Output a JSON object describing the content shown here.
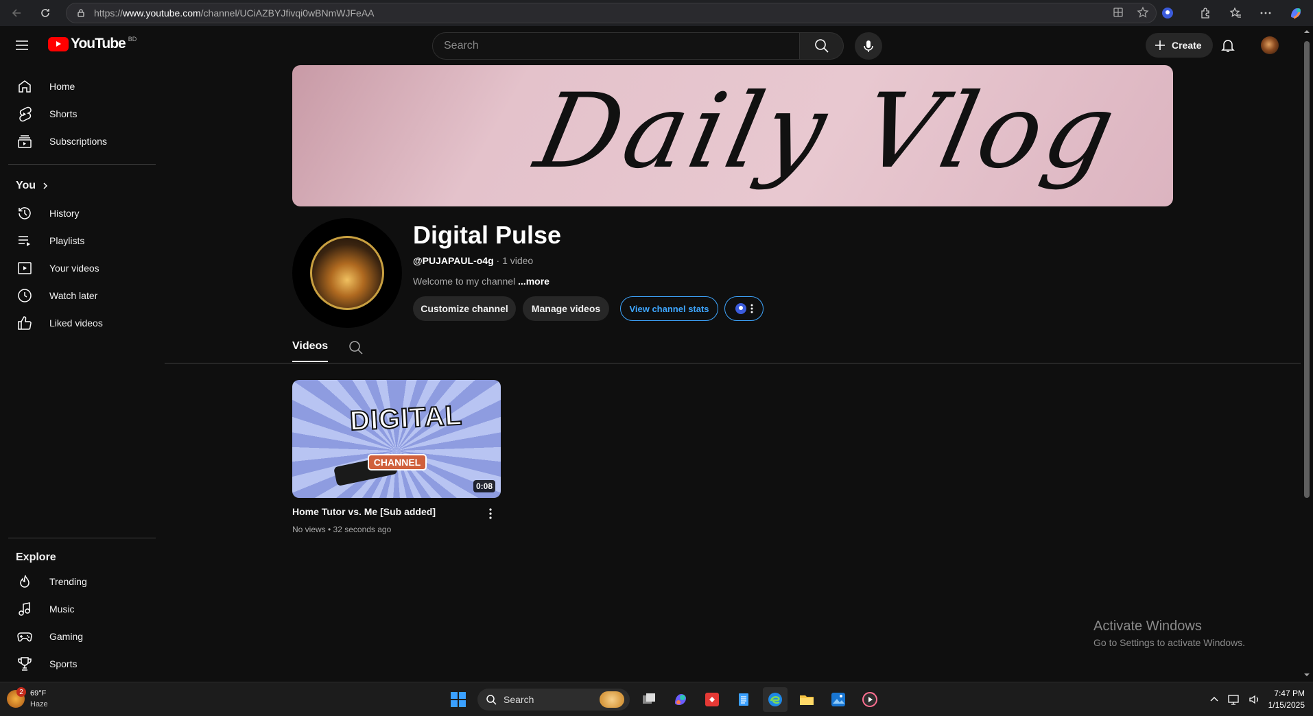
{
  "browser": {
    "url_prefix": "https://",
    "url_host": "www.youtube.com",
    "url_path": "/channel/UCiAZBYJfivqi0wBNmWJFeAA"
  },
  "header": {
    "logo_text": "YouTube",
    "country_code": "BD",
    "search_placeholder": "Search",
    "create_label": "Create"
  },
  "sidebar": {
    "main": [
      {
        "label": "Home",
        "icon": "home-icon"
      },
      {
        "label": "Shorts",
        "icon": "shorts-icon"
      },
      {
        "label": "Subscriptions",
        "icon": "subscriptions-icon"
      }
    ],
    "you_title": "You",
    "you_items": [
      {
        "label": "History",
        "icon": "history-icon"
      },
      {
        "label": "Playlists",
        "icon": "playlists-icon"
      },
      {
        "label": "Your videos",
        "icon": "your-videos-icon"
      },
      {
        "label": "Watch later",
        "icon": "watch-later-icon"
      },
      {
        "label": "Liked videos",
        "icon": "liked-videos-icon"
      }
    ],
    "explore_title": "Explore",
    "explore_items": [
      {
        "label": "Trending",
        "icon": "trending-icon"
      },
      {
        "label": "Music",
        "icon": "music-icon"
      },
      {
        "label": "Gaming",
        "icon": "gaming-icon"
      },
      {
        "label": "Sports",
        "icon": "sports-icon"
      }
    ]
  },
  "banner": {
    "text": "Daily Vlog"
  },
  "channel": {
    "name": "Digital Pulse",
    "handle": "@PUJAPAUL-o4g",
    "video_count": " · 1 video",
    "description": "Welcome to my channel ",
    "more": "...more",
    "buttons": {
      "customize": "Customize channel",
      "manage": "Manage videos",
      "stats": "View channel stats"
    }
  },
  "tabs": {
    "videos": "Videos"
  },
  "videos": [
    {
      "title": "Home Tutor vs. Me [Sub added]",
      "meta": "No views • 32 seconds ago",
      "duration": "0:08",
      "thumb_title": "DIGITAL",
      "thumb_tag": "CHANNEL"
    }
  ],
  "watermark": {
    "line1": "Activate Windows",
    "line2": "Go to Settings to activate Windows."
  },
  "taskbar": {
    "temperature": "69°F",
    "weather": "Haze",
    "weather_badge": "2",
    "search_label": "Search",
    "time": "7:47 PM",
    "date": "1/15/2025"
  },
  "colors": {
    "background": "#0f0f0f",
    "accent_red": "#ff0000",
    "link_blue": "#3ea6ff",
    "banner_pink": "#e4c2cb"
  }
}
